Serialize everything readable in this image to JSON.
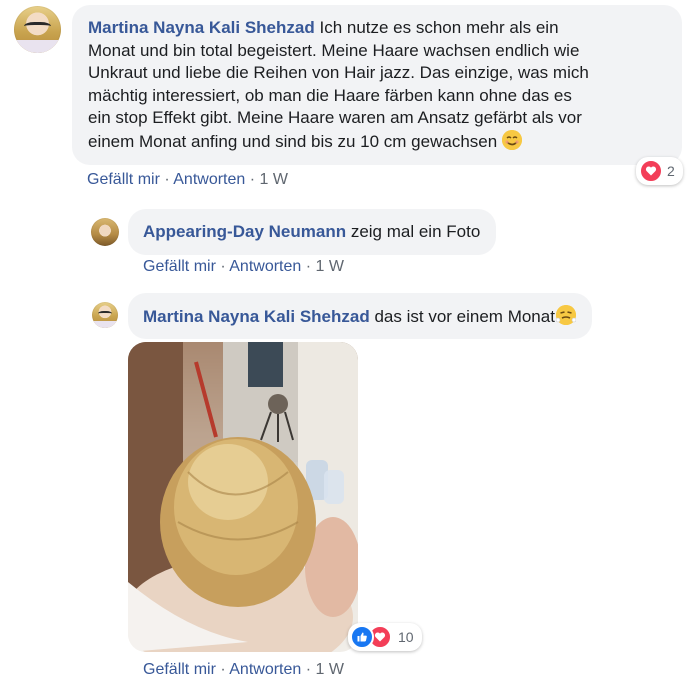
{
  "comments": [
    {
      "author": "Martina Nayna Kali Shehzad",
      "lines": [
        "Ich nutze es schon mehr als ein",
        "Monat und bin total begeistert. Meine Haare wachsen endlich wie",
        "Unkraut und liebe die Reihen von Hair jazz. Das einzige, was mich",
        "mächtig interessiert, ob man die Haare färben kann ohne das es",
        "ein stop Effekt gibt. Meine Haare waren am Ansatz gefärbt als vor",
        "einem Monat anfing und sind bis zu 10 cm gewachsen"
      ],
      "emoji": "smiling-face-emoji",
      "actions": {
        "like": "Gefällt mir",
        "reply": "Antworten",
        "time": "1 W",
        "separator": "·"
      },
      "reactions": {
        "icons": [
          "heart"
        ],
        "count": "2"
      }
    },
    {
      "author": "Appearing-Day Neumann",
      "text": "zeig mal ein Foto",
      "actions": {
        "like": "Gefällt mir",
        "reply": "Antworten",
        "time": "1 W",
        "separator": "·"
      }
    },
    {
      "author": "Martina Nayna Kali Shehzad",
      "text": "das ist vor einem Monat",
      "emoji": "triumph-face-emoji",
      "photo": "photo of blonde hair viewed from above",
      "actions": {
        "like": "Gefällt mir",
        "reply": "Antworten",
        "time": "1 W",
        "separator": "·"
      },
      "reactions": {
        "icons": [
          "like",
          "heart"
        ],
        "count": "10"
      }
    }
  ],
  "colors": {
    "name": "#385898",
    "bubble": "#f2f3f5",
    "meta": "#606770",
    "heart": "#f33e58",
    "like": "#1877f2"
  }
}
